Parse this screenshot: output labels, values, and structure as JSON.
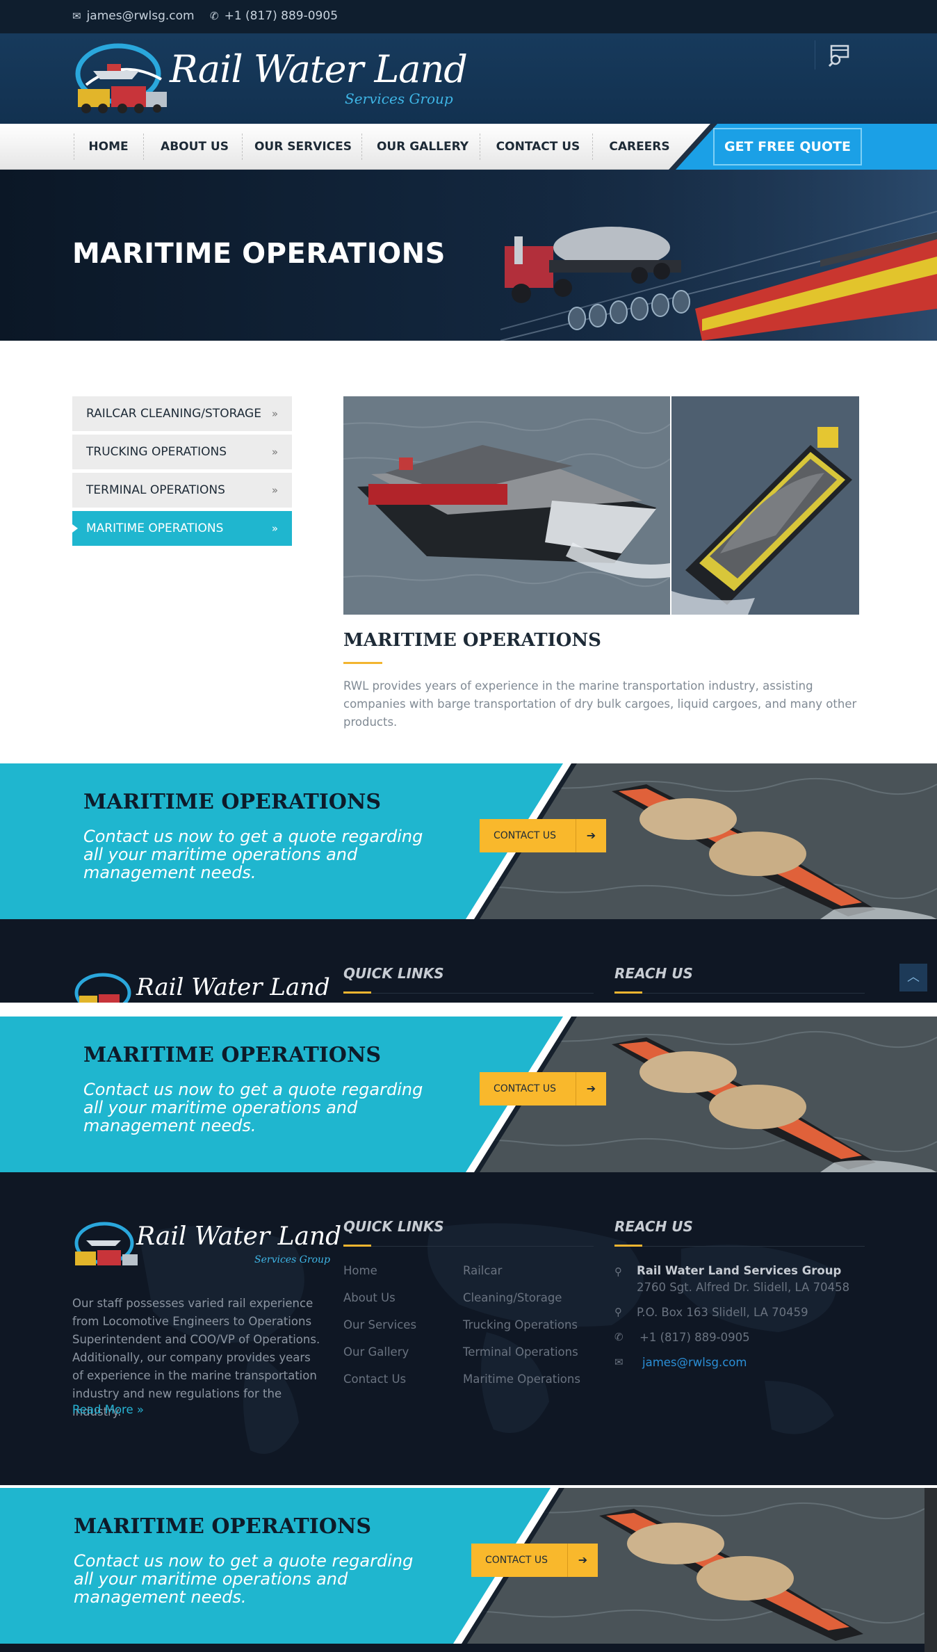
{
  "topbar": {
    "email": "james@rwlsg.com",
    "phone": "+1 (817) 889-0905",
    "email_icon": "envelope-icon",
    "phone_icon": "phone-icon"
  },
  "logo": {
    "title": "Rail Water Land",
    "subtitle": "Services Group"
  },
  "nav": {
    "items": [
      "HOME",
      "ABOUT US",
      "OUR SERVICES",
      "OUR GALLERY",
      "CONTACT US",
      "CAREERS"
    ],
    "quote": "GET FREE QUOTE"
  },
  "banner": {
    "title": "MARITIME OPERATIONS"
  },
  "sidebar": {
    "items": [
      {
        "label": "RAILCAR CLEANING/STORAGE"
      },
      {
        "label": "TRUCKING OPERATIONS"
      },
      {
        "label": "TERMINAL OPERATIONS"
      },
      {
        "label": "MARITIME OPERATIONS",
        "active": true
      }
    ]
  },
  "content": {
    "title": "MARITIME OPERATIONS",
    "text": "RWL provides years of experience in the marine transportation industry, assisting companies with barge transportation of dry bulk cargoes, liquid cargoes, and many other products."
  },
  "cta": {
    "title": "MARITIME OPERATIONS",
    "text": "Contact us now to get a quote regarding all your maritime operations and management needs.",
    "button": "CONTACT US"
  },
  "footer": {
    "quick_links_title": "QUICK LINKS",
    "reach_us_title": "REACH US",
    "about": "Our staff possesses varied rail experience from Locomotive Engineers to Operations Superintendent and COO/VP of Operations. Additionally, our company provides years of experience in the marine transportation industry and new regulations for the industry.",
    "read_more": "Read More »",
    "links_col1": [
      "Home",
      "About Us",
      "Our Services",
      "Our Gallery",
      "Contact Us"
    ],
    "links_col2": [
      "Railcar",
      "Cleaning/Storage",
      "Trucking Operations",
      "Terminal Operations",
      "Maritime Operations"
    ],
    "company": "Rail Water Land Services Group",
    "address": "2760 Sgt. Alfred Dr. Slidell, LA 70458",
    "po_box": "P.O. Box 163 Slidell, LA 70459",
    "phone": "+1 (817) 889-0905",
    "email": "james@rwlsg.com"
  },
  "colors": {
    "accent_cyan": "#1fb6cf",
    "accent_yellow": "#f9b82c",
    "quote_blue": "#1ba0e6",
    "dark": "#0f1724"
  }
}
